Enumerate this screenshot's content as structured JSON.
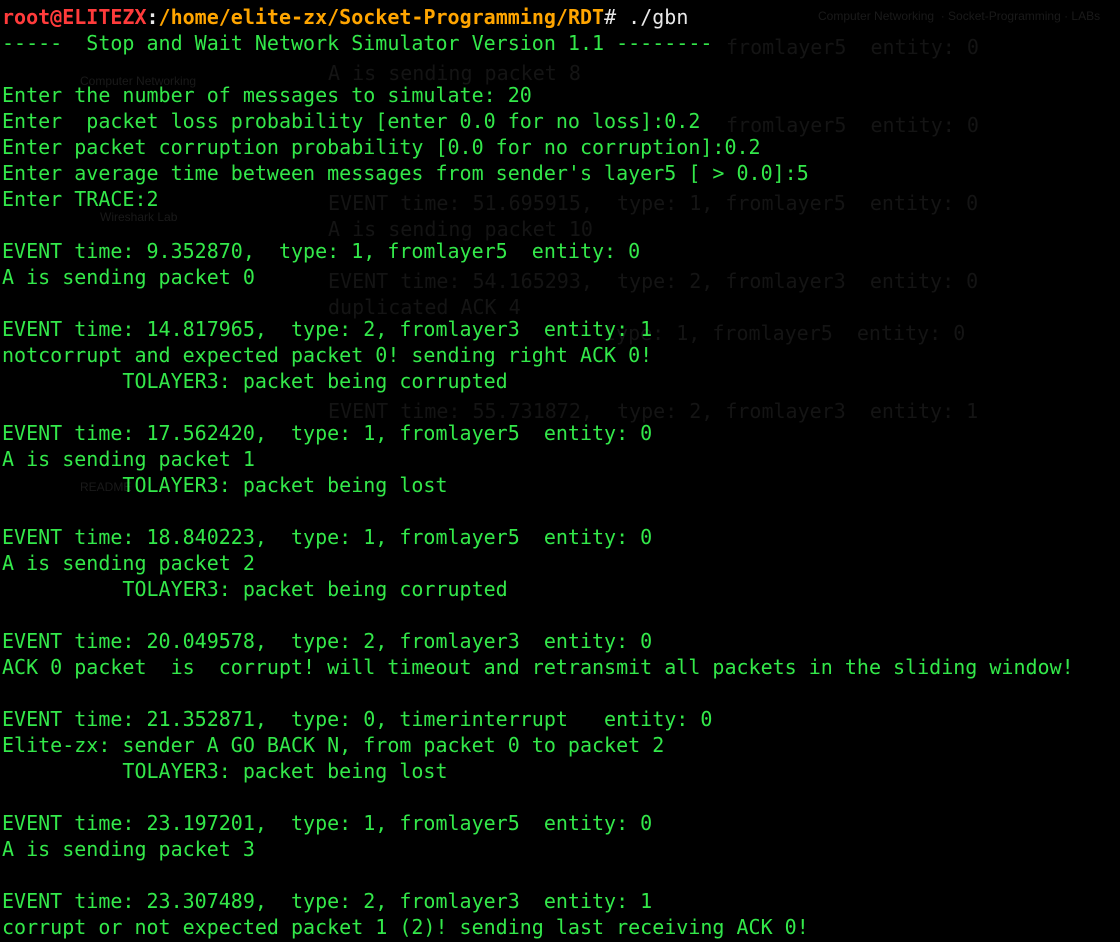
{
  "prompt": {
    "user_host": "root@ELITEZX",
    "separator": ":",
    "path": "/home/elite-zx/Socket-Programming/RDT",
    "symbol": "# ",
    "command": "./gbn"
  },
  "output_lines": [
    "-----  Stop and Wait Network Simulator Version 1.1 --------",
    "",
    "Enter the number of messages to simulate: 20",
    "Enter  packet loss probability [enter 0.0 for no loss]:0.2",
    "Enter packet corruption probability [0.0 for no corruption]:0.2",
    "Enter average time between messages from sender's layer5 [ > 0.0]:5",
    "Enter TRACE:2",
    "",
    "EVENT time: 9.352870,  type: 1, fromlayer5  entity: 0",
    "A is sending packet 0",
    "",
    "EVENT time: 14.817965,  type: 2, fromlayer3  entity: 1",
    "notcorrupt and expected packet 0! sending right ACK 0!",
    "          TOLAYER3: packet being corrupted",
    "",
    "EVENT time: 17.562420,  type: 1, fromlayer5  entity: 0",
    "A is sending packet 1",
    "          TOLAYER3: packet being lost",
    "",
    "EVENT time: 18.840223,  type: 1, fromlayer5  entity: 0",
    "A is sending packet 2",
    "          TOLAYER3: packet being corrupted",
    "",
    "EVENT time: 20.049578,  type: 2, fromlayer3  entity: 0",
    "ACK 0 packet  is  corrupt! will timeout and retransmit all packets in the sliding window!",
    "",
    "EVENT time: 21.352871,  type: 0, timerinterrupt   entity: 0",
    "Elite-zx: sender A GO BACK N, from packet 0 to packet 2",
    "          TOLAYER3: packet being lost",
    "",
    "EVENT time: 23.197201,  type: 1, fromlayer5  entity: 0",
    "A is sending packet 3",
    "",
    "EVENT time: 23.307489,  type: 2, fromlayer3  entity: 1",
    "corrupt or not expected packet 1 (2)! sending last receiving ACK 0!"
  ],
  "background_ghost": {
    "window_title": "Computer Networking  · Socket-Programming · LABs",
    "faint_lines": [
      "fromlayer5  entity: 0",
      "A is sending packet 8",
      "fromlayer5  entity: 0",
      "EVENT time: 51.695915,  type: 1, fromlayer5  entity: 0",
      "A is sending packet 10",
      "EVENT time: 54.165293,  type: 2, fromlayer3  entity: 0",
      "duplicated ACK 4",
      "type: 1, fromlayer5  entity: 0",
      "EVENT time: 55.731872,  type: 2, fromlayer3  entity: 1"
    ],
    "faint_sidebar": [
      "Computer Networking",
      "Wireshark Lab",
      "README"
    ]
  },
  "colors": {
    "background": "#000000",
    "output_text": "#33e84a",
    "prompt_user": "#ff3b3b",
    "prompt_path": "#ffa500",
    "prompt_plain": "#e8e8e8"
  }
}
